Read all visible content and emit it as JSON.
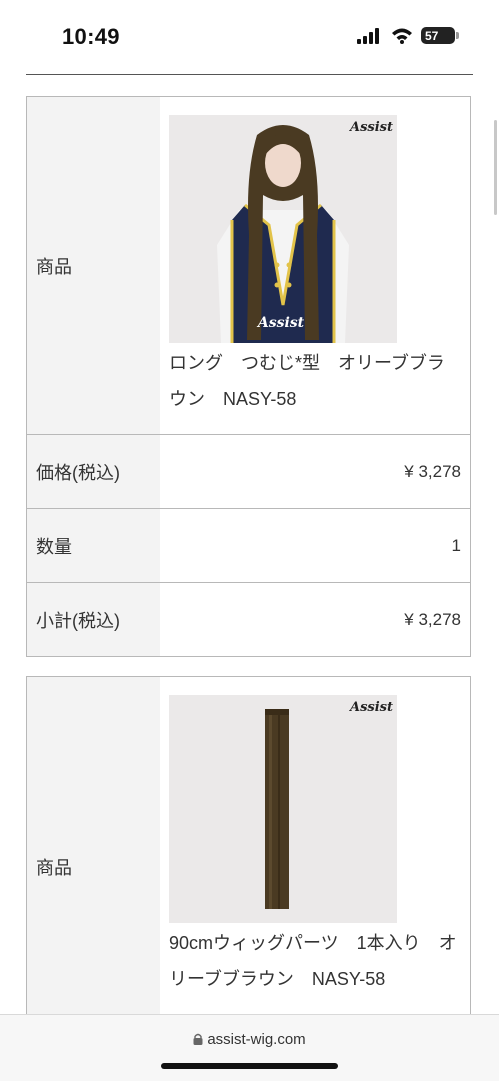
{
  "status": {
    "time": "10:49",
    "battery": "57"
  },
  "items": [
    {
      "product_label": "商品",
      "product_name": "ロング　つむじ*型　オリーブブラウン　NASY-58",
      "image_logo": "Assist",
      "image_desc": "long-wig-model",
      "price_label": "価格(税込)",
      "price": "¥ 3,278",
      "qty_label": "数量",
      "qty": "1",
      "subtotal_label": "小計(税込)",
      "subtotal": "¥ 3,278"
    },
    {
      "product_label": "商品",
      "product_name": "90cmウィッグパーツ　1本入り　オリーブブラウン　NASY-58",
      "image_logo": "Assist",
      "image_desc": "hair-extension-strip"
    }
  ],
  "browser": {
    "url": "assist-wig.com"
  },
  "colors": {
    "hair": "#4a3a22",
    "vest": "#1f2a4f",
    "trim": "#e2c34a"
  }
}
